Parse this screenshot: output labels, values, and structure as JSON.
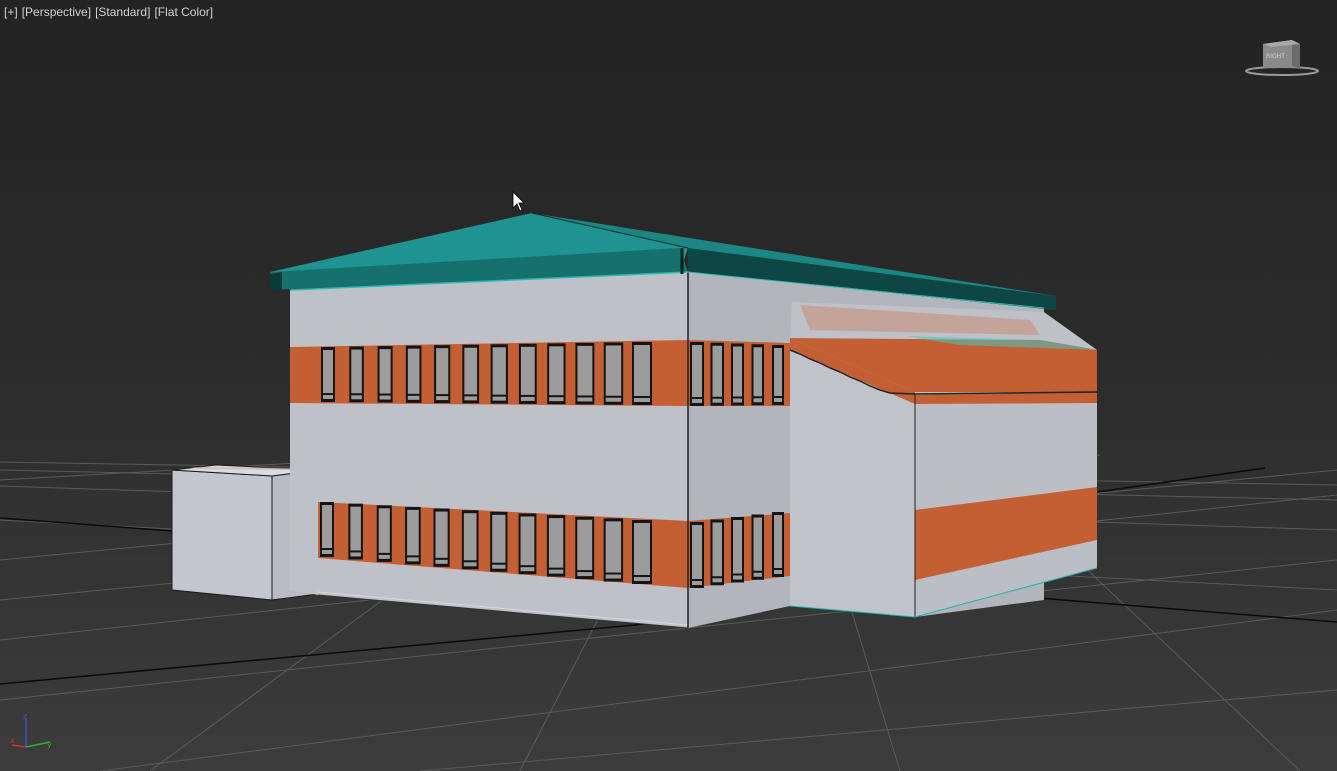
{
  "viewport": {
    "menu_plus": "[+]",
    "view_mode": "[Perspective]",
    "shading_preset": "[Standard]",
    "display_mode": "[Flat Color]"
  },
  "viewcube": {
    "face_label": "RIGHT"
  },
  "axis_gizmo": {
    "z_label": "z",
    "x_label": "x",
    "y_label": "y"
  },
  "colors": {
    "background": "#2b2b2b",
    "grid": "#5a5a5a",
    "grid_major": "#0a0a0a",
    "wall": "#bdbfc7",
    "wall_shadow": "#a8aab2",
    "band": "#c45f34",
    "roof": "#1d8f8c",
    "roof_dark": "#0c3f3e",
    "window": "#9c9c9c",
    "axis_x": "#c83232",
    "axis_y": "#2fb02f",
    "axis_z": "#3b52d6"
  }
}
